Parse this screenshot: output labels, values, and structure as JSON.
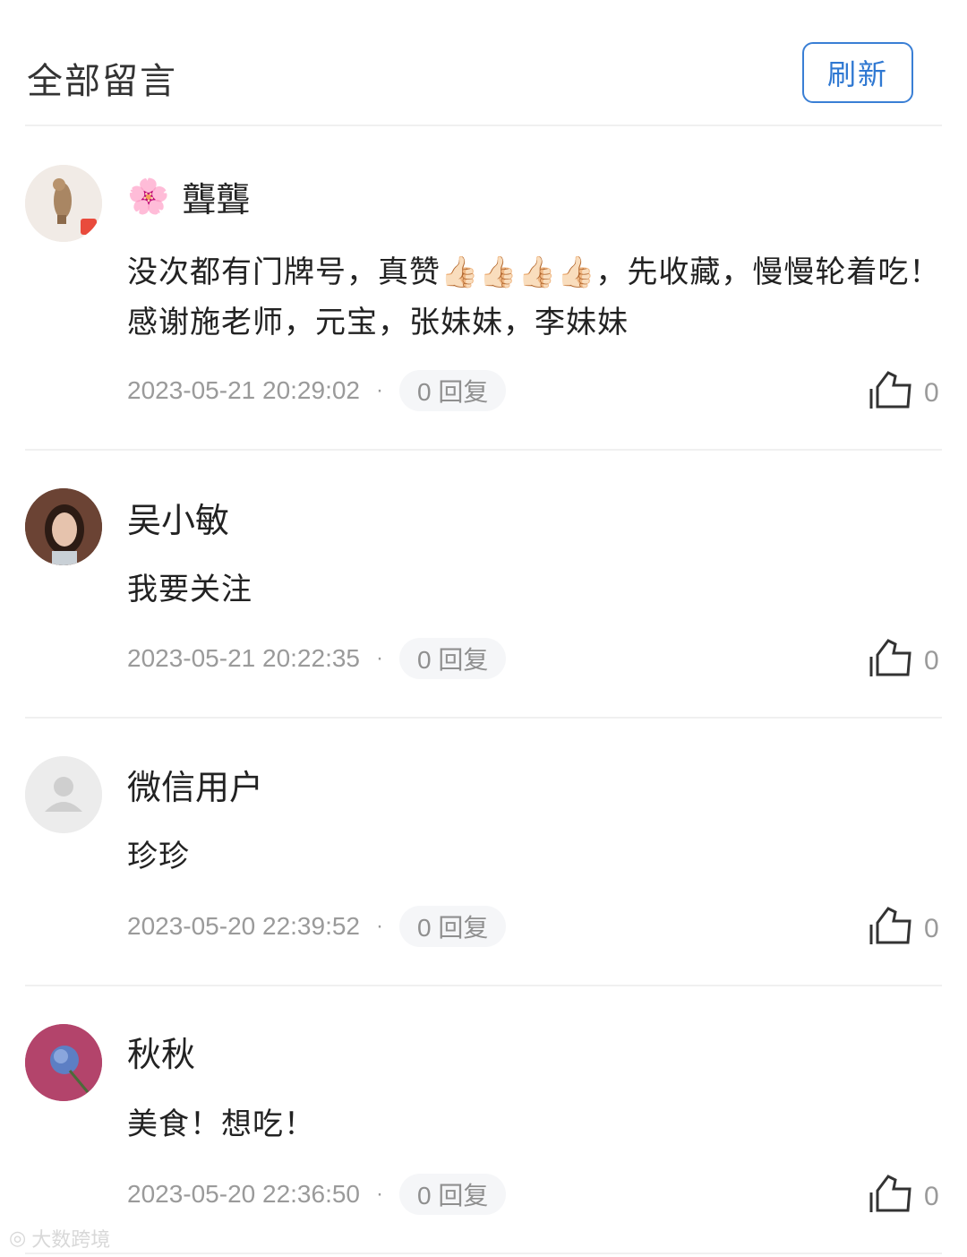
{
  "header": {
    "title": "全部留言",
    "refresh_label": "刷新"
  },
  "comments": [
    {
      "name": "聾聾",
      "name_icon": "cherry-blossom",
      "content": "没次都有门牌号，真赞👍🏻👍🏻👍🏻👍🏻，先收藏，慢慢轮着吃！感谢施老师，元宝，张妹妹，李妹妹",
      "time": "2023-05-21 20:29:02",
      "reply": "0 回复",
      "likes": "0"
    },
    {
      "name": "吴小敏",
      "content": "我要关注",
      "time": "2023-05-21 20:22:35",
      "reply": "0 回复",
      "likes": "0"
    },
    {
      "name": "微信用户",
      "content": "珍珍",
      "time": "2023-05-20 22:39:52",
      "reply": "0 回复",
      "likes": "0"
    },
    {
      "name": "秋秋",
      "content": "美食！想吃！",
      "time": "2023-05-20 22:36:50",
      "reply": "0 回复",
      "likes": "0"
    }
  ],
  "watermark": "大数跨境"
}
